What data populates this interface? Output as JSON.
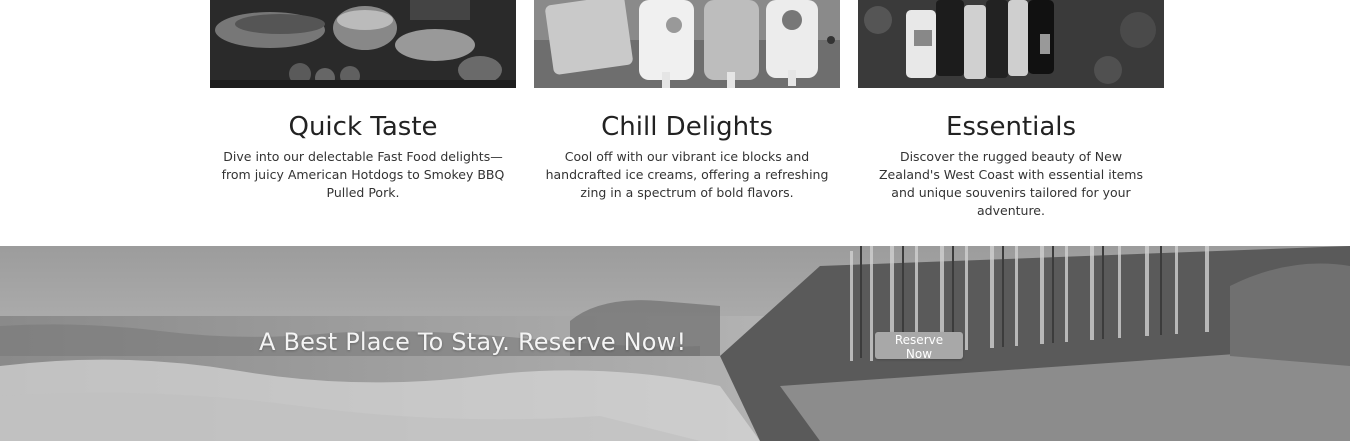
{
  "cards": [
    {
      "title": "Quick Taste",
      "text": "Dive into our delectable Fast Food delights—from juicy American Hotdogs to Smokey BBQ Pulled Pork.",
      "image": "fast-food-photo"
    },
    {
      "title": "Chill Delights",
      "text": "Cool off with our vibrant ice blocks and handcrafted ice creams, offering a refreshing zing in a spectrum of bold flavors.",
      "image": "ice-blocks-photo"
    },
    {
      "title": "Essentials",
      "text": "Discover the rugged beauty of New Zealand's West Coast with essential items and unique souvenirs tailored for your adventure.",
      "image": "essentials-photo"
    }
  ],
  "banner": {
    "headline": "A Best Place To Stay. Reserve Now!",
    "button_label": "Reserve Now",
    "image": "west-coast-beach-photo"
  }
}
